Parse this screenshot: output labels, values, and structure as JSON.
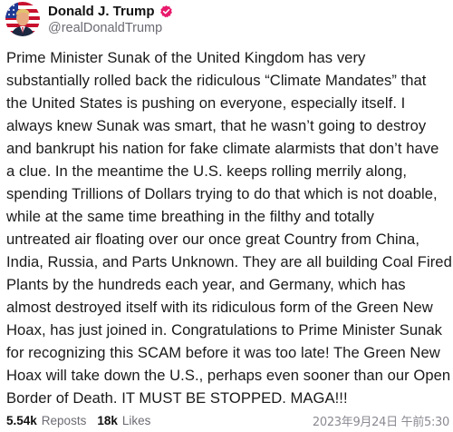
{
  "post": {
    "author": {
      "display_name": "Donald J. Trump",
      "handle": "@realDonaldTrump",
      "verified": true,
      "avatar_icon": "avatar-portrait-flag"
    },
    "body": "Prime Minister Sunak of the United Kingdom has very\nsubstantially rolled back the ridiculous “Climate Mandates” that\nthe United States is pushing on everyone, especially itself. I\nalways knew Sunak was smart, that he wasn’t going to destroy\nand bankrupt his nation for fake climate alarmists that don’t have\na clue. In the meantime the U.S. keeps rolling merrily along,\nspending Trillions of Dollars trying to do that which is not doable,\nwhile at the same time breathing in the filthy and totally\nuntreated air floating over our once great Country from China,\nIndia, Russia, and Parts Unknown. They are all building Coal Fired\nPlants by the hundreds each year, and Germany, which has\nalmost destroyed itself with its ridiculous form of the Green New\nHoax, has just joined in. Congratulations to Prime Minister Sunak\nfor recognizing this SCAM before it was too late! The Green New\nHoax will take down the U.S., perhaps even sooner than our Open\nBorder of Death. IT MUST BE STOPPED. MAGA!!!",
    "stats": {
      "reposts_count": "5.54k",
      "reposts_label": "Reposts",
      "likes_count": "18k",
      "likes_label": "Likes"
    },
    "timestamp": "2023年9月24日 午前5:30"
  },
  "colors": {
    "verified_badge": "#e8196c",
    "text_primary": "#1a1a1a",
    "text_secondary": "#6b6b73"
  }
}
